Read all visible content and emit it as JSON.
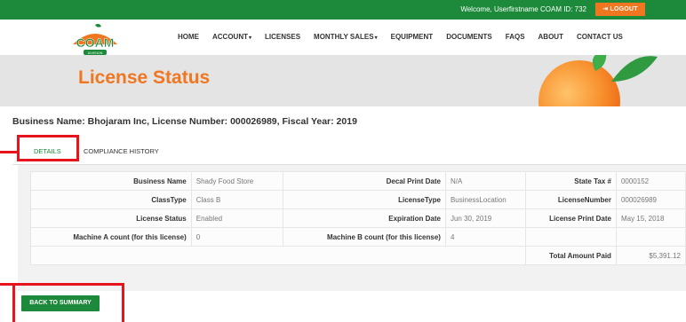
{
  "topbar": {
    "welcome": "Welcome, Userfirstname  COAM ID: 732",
    "logout_icon": "logout-arrow-icon",
    "logout_label": "LOGOUT"
  },
  "logo": {
    "text": "COAM",
    "subtext": "DIVISION"
  },
  "nav": {
    "items": [
      "HOME",
      "ACCOUNT",
      "LICENSES",
      "MONTHLY SALES",
      "EQUIPMENT",
      "DOCUMENTS",
      "FAQS",
      "ABOUT",
      "CONTACT US"
    ],
    "dropdown_icon": "caret-down-icon"
  },
  "hero": {
    "title": "License Status"
  },
  "business_line": "Business Name: Bhojaram Inc, License Number: 000026989, Fiscal Year: 2019",
  "tabs": {
    "details": "DETAILS",
    "compliance": "COMPLIANCE HISTORY"
  },
  "details": {
    "rows": [
      [
        {
          "label": "Business Name",
          "value": "Shady Food Store"
        },
        {
          "label": "Decal Print Date",
          "value": "N/A"
        },
        {
          "label": "State Tax #",
          "value": "0000152"
        }
      ],
      [
        {
          "label": "ClassType",
          "value": "Class B"
        },
        {
          "label": "LicenseType",
          "value": "BusinessLocation"
        },
        {
          "label": "LicenseNumber",
          "value": "000026989"
        }
      ],
      [
        {
          "label": "License Status",
          "value": "Enabled"
        },
        {
          "label": "Expiration Date",
          "value": "Jun 30, 2019"
        },
        {
          "label": "License Print Date",
          "value": "May 15, 2018"
        }
      ],
      [
        {
          "label": "Machine A count (for this license)",
          "value": "0"
        },
        {
          "label": "Machine B count (for this license)",
          "value": "4"
        },
        {
          "label": "",
          "value": ""
        }
      ]
    ],
    "total_label": "Total Amount Paid",
    "total_value": "$5,391.12"
  },
  "back_button": "BACK TO SUMMARY",
  "colors": {
    "brand_green": "#1c8a3a",
    "accent_orange": "#f0761f",
    "annotation_red": "#e8141d"
  }
}
